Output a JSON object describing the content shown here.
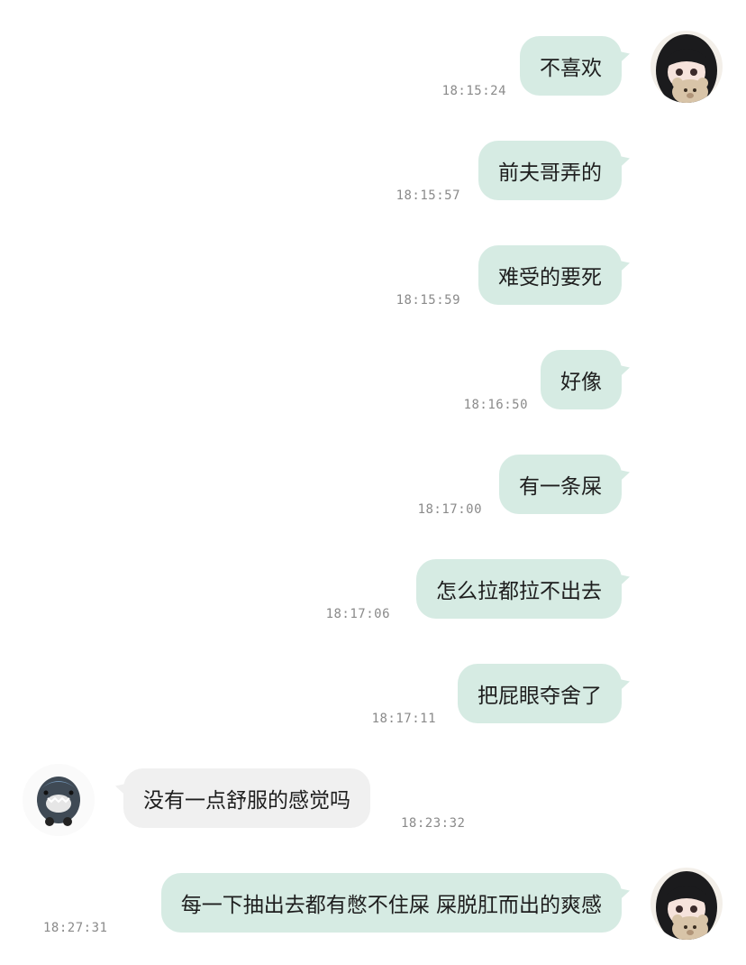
{
  "messages": [
    {
      "side": "out",
      "text": "不喜欢",
      "time": "18:15:24"
    },
    {
      "side": "out",
      "text": "前夫哥弄的",
      "time": "18:15:57"
    },
    {
      "side": "out",
      "text": "难受的要死",
      "time": "18:15:59"
    },
    {
      "side": "out",
      "text": "好像",
      "time": "18:16:50"
    },
    {
      "side": "out",
      "text": "有一条屎",
      "time": "18:17:00"
    },
    {
      "side": "out",
      "text": "怎么拉都拉不出去",
      "time": "18:17:06"
    },
    {
      "side": "out",
      "text": "把屁眼夺舍了",
      "time": "18:17:11"
    },
    {
      "side": "in",
      "text": "没有一点舒服的感觉吗",
      "time": "18:23:32"
    },
    {
      "side": "out",
      "text": "每一下抽出去都有憋不住屎 屎脱肛而出的爽感",
      "time": "18:27:31"
    }
  ],
  "colors": {
    "outgoing_bubble": "#d6ebe3",
    "incoming_bubble": "#f0f0f0",
    "timestamp": "#8a8a8a"
  },
  "avatars": {
    "me": "girl-with-teddy-bear-avatar",
    "other": "shark-avatar"
  }
}
